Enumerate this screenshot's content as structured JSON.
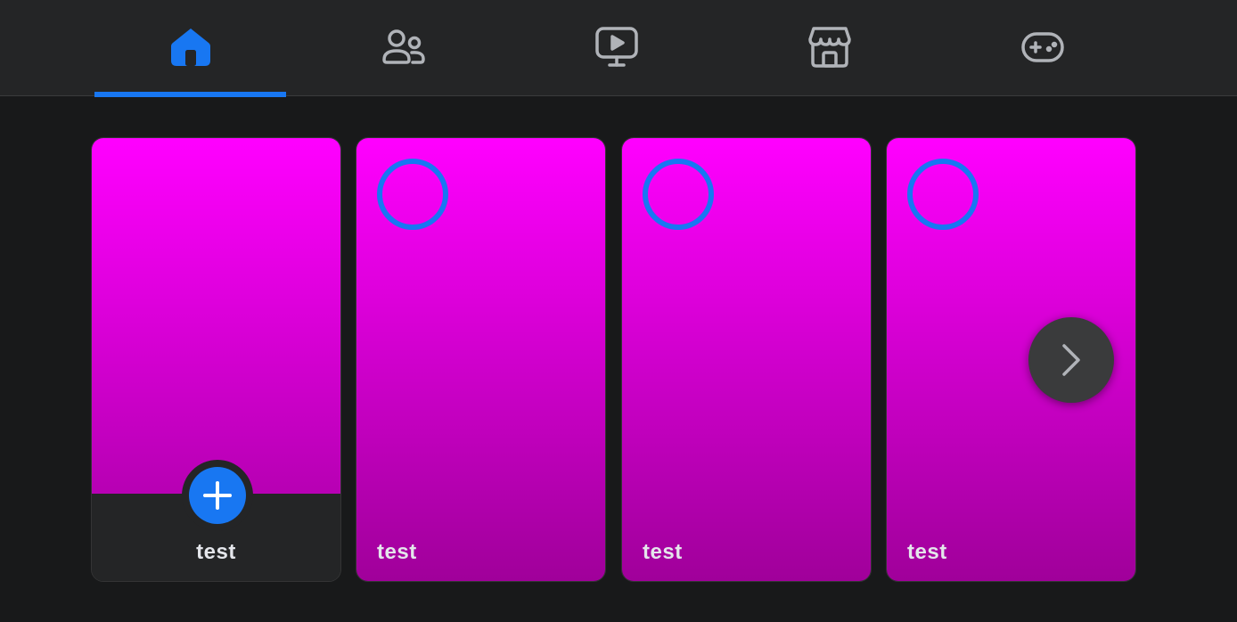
{
  "nav": {
    "tabs": [
      {
        "name": "home",
        "icon": "home-icon",
        "active": true
      },
      {
        "name": "friends",
        "icon": "friends-icon",
        "active": false
      },
      {
        "name": "watch",
        "icon": "watch-icon",
        "active": false
      },
      {
        "name": "marketplace",
        "icon": "marketplace-icon",
        "active": false
      },
      {
        "name": "gaming",
        "icon": "gaming-icon",
        "active": false
      }
    ]
  },
  "stories": {
    "create": {
      "label": "test",
      "action_icon": "plus-icon"
    },
    "items": [
      {
        "label": "test"
      },
      {
        "label": "test"
      },
      {
        "label": "test"
      }
    ],
    "next_icon": "chevron-right-icon"
  },
  "colors": {
    "accent": "#1877f2",
    "page_bg": "#18191a",
    "bar_bg": "#242526",
    "icon_inactive": "#b0b3b8",
    "card_gradient_top": "#ff00ff",
    "card_gradient_bottom": "#a0009a"
  }
}
